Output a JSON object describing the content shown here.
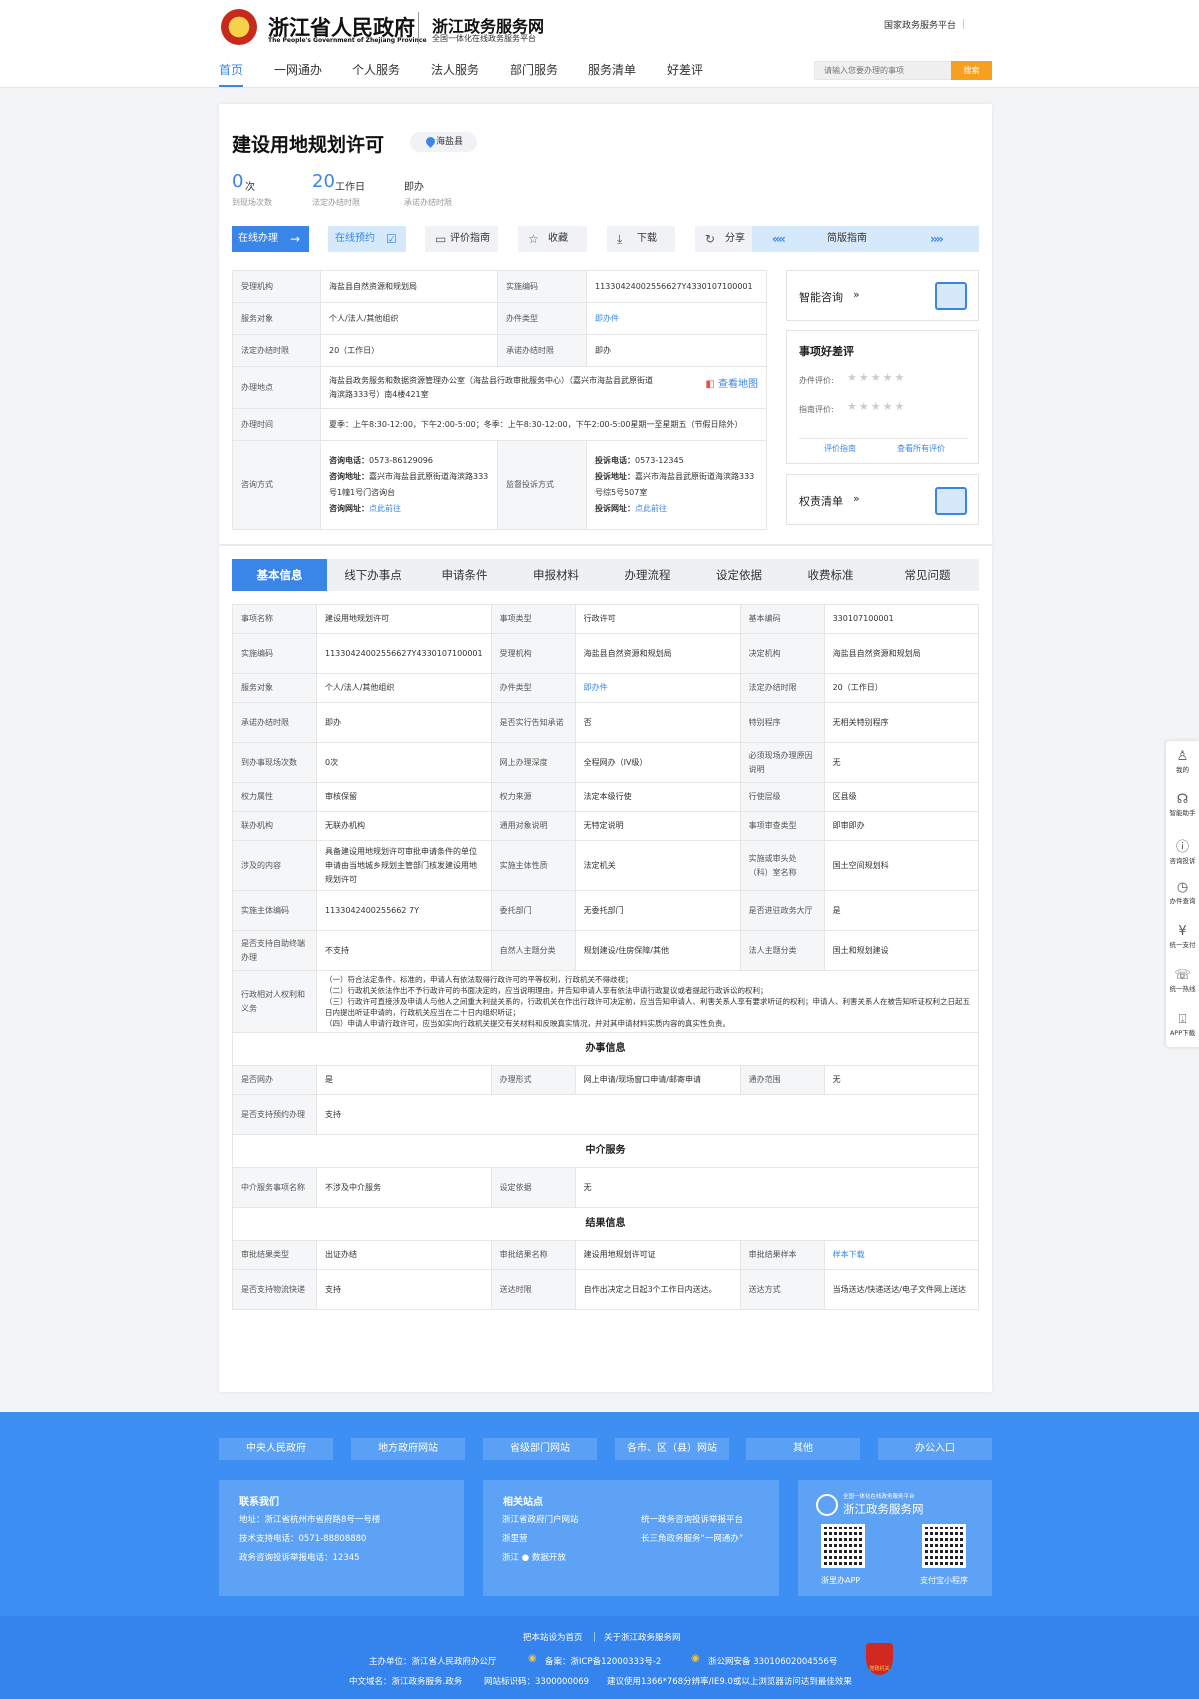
{
  "header": {
    "gov_cn": "浙江省人民政府",
    "gov_en": "The People's Government of Zhejiang Province",
    "site_title": "浙江政务服务网",
    "site_subtitle": "全国一体化在线政务服务平台",
    "national_link": "国家政务服务平台"
  },
  "nav": {
    "items": [
      "首页",
      "一网通办",
      "个人服务",
      "法人服务",
      "部门服务",
      "服务清单",
      "好差评"
    ],
    "search_placeholder": "请输入您要办理的事项",
    "search_button": "搜索"
  },
  "item": {
    "title": "建设用地规划许可",
    "region": "海盐县",
    "stats": [
      {
        "num": "0",
        "unit": "次",
        "label": "到现场次数"
      },
      {
        "num": "20",
        "unit": "工作日",
        "label": "法定办结时限"
      },
      {
        "num": "",
        "unit": "即办",
        "label": "承诺办结时限"
      }
    ],
    "buttons": {
      "online": "在线办理",
      "appointment": "在线预约",
      "evaluate_guide": "评价指南",
      "favorite": "收藏",
      "download": "下载",
      "share": "分享",
      "simple_guide": "简版指南"
    }
  },
  "info": {
    "accept_org_k": "受理机构",
    "accept_org_v": "海盐县自然资源和规划局",
    "impl_code_k": "实施编码",
    "impl_code_v": "11330424002556627Y4330107100001",
    "target_k": "服务对象",
    "target_v": "个人/法人/其他组织",
    "type_k": "办件类型",
    "type_v": "即办件",
    "legal_k": "法定办结时限",
    "legal_v": "20（工作日）",
    "promise_k": "承诺办结时限",
    "promise_v": "即办",
    "place_k": "办理地点",
    "place_v": "海盐县政务服务和数据资源管理办公室（海盐县行政审批服务中心）（嘉兴市海盐县武原街道海滨路333号）南4楼421室",
    "map_link": "查看地图",
    "time_k": "办理时间",
    "time_v": "夏季：上午8:30-12:00，下午2:00-5:00；冬季：上午8:30-12:00，下午2:00-5:00星期一至星期五（节假日除外）",
    "consult_k": "咨询方式",
    "consult_phone_k": "咨询电话：",
    "consult_phone_v": "0573-86129096",
    "consult_addr_k": "咨询地址：",
    "consult_addr_v": "嘉兴市海盐县武原街道海滨路333号1幢1号门咨询台",
    "consult_web_k": "咨询网址：",
    "consult_web_v": "点此前往",
    "complaint_k": "监督投诉方式",
    "complaint_phone_k": "投诉电话：",
    "complaint_phone_v": "0573-12345",
    "complaint_addr_k": "投诉地址：",
    "complaint_addr_v": "嘉兴市海盐县武原街道海滨路333号综5号507室",
    "complaint_web_k": "投诉网址：",
    "complaint_web_v": "点此前往"
  },
  "side": {
    "smart": "智能咨询",
    "review_title": "事项好差评",
    "review_rows": [
      "办件评价:",
      "指南评价:"
    ],
    "review_links": [
      "评价指南",
      "查看所有评价"
    ],
    "power_list": "权责清单"
  },
  "tabs": [
    "基本信息",
    "线下办事点",
    "申请条件",
    "申报材料",
    "办理流程",
    "设定依据",
    "收费标准",
    "常见问题"
  ],
  "basic": {
    "rows": [
      [
        "事项名称",
        "建设用地规划许可",
        "事项类型",
        "行政许可",
        "基本编码",
        "330107100001"
      ],
      [
        "实施编码",
        "11330424002556627Y4330107100001",
        "受理机构",
        "海盐县自然资源和规划局",
        "决定机构",
        "海盐县自然资源和规划局"
      ],
      [
        "服务对象",
        "个人/法人/其他组织",
        "办件类型",
        "即办件",
        "法定办结时限",
        "20（工作日）"
      ],
      [
        "承诺办结时限",
        "即办",
        "是否实行告知承诺",
        "否",
        "特别程序",
        "无相关特别程序"
      ],
      [
        "到办事现场次数",
        "0次",
        "网上办理深度",
        "全程网办（IV级）",
        "必须现场办理原因说明",
        "无"
      ],
      [
        "权力属性",
        "审核保留",
        "权力来源",
        "法定本级行使",
        "行使层级",
        "区县级"
      ],
      [
        "联办机构",
        "无联办机构",
        "通用对象说明",
        "无特定说明",
        "事项审查类型",
        "即审即办"
      ],
      [
        "涉及的内容",
        "具备建设用地规划许可审批申请条件的单位申请由当地城乡规划主管部门核发建设用地规划许可",
        "实施主体性质",
        "法定机关",
        "实施或审头处（科）室名称",
        "国土空间规划科"
      ],
      [
        "实施主体编码",
        "1133042400255662 7Y",
        "委托部门",
        "无委托部门",
        "是否进驻政务大厅",
        "是"
      ],
      [
        "是否支持自助终端办理",
        "不支持",
        "自然人主题分类",
        "规划建设/住房保障/其他",
        "法人主题分类",
        "国土和规划建设"
      ]
    ],
    "rights_k": "行政相对人权利和义务",
    "rights_v": [
      "（一）符合法定条件、标准的，申请人有依法取得行政许可的平等权利，行政机关不得歧视；",
      "（二）行政机关依法作出不予行政许可的书面决定的，应当说明理由，并告知申请人享有依法申请行政复议或者提起行政诉讼的权利；",
      "（三）行政许可直接涉及申请人与他人之间重大利益关系的，行政机关在作出行政许可决定前，应当告知申请人、利害关系人享有要求听证的权利；申请人、利害关系人在被告知听证权利之日起五日内提出听证申请的，行政机关应当在二十日内组织听证；",
      "（四）申请人申请行政许可，应当如实向行政机关提交有关材料和反映真实情况，并对其申请材料实质内容的真实性负责。"
    ],
    "section_office": "办事信息",
    "office_rows": [
      [
        "是否网办",
        "是",
        "办理形式",
        "网上申请/现场窗口申请/邮寄申请",
        "通办范围",
        "无"
      ]
    ],
    "office_extra": [
      "是否支持预约办理",
      "支持"
    ],
    "section_agency": "中介服务",
    "agency_row": [
      "中介服务事项名称",
      "不涉及中介服务",
      "设定依据",
      "无"
    ],
    "section_result": "结果信息",
    "result_rows": [
      [
        "审批结果类型",
        "出证办结",
        "审批结果名称",
        "建设用地规划许可证",
        "审批结果样本",
        "样本下载"
      ],
      [
        "是否支持物流快递",
        "支持",
        "送达时限",
        "自作出决定之日起3个工作日内送达。",
        "送达方式",
        "当场送达/快递送达/电子文件网上送达"
      ]
    ]
  },
  "float": [
    "我的",
    "智能助手",
    "咨询投诉",
    "办件查询",
    "统一支付",
    "统一热线",
    "APP下载"
  ],
  "footer": {
    "links": [
      "中央人民政府",
      "地方政府网站",
      "省级部门网站",
      "各市、区（县）网站",
      "其他",
      "办公入口"
    ],
    "contact_h": "联系我们",
    "contact": [
      "地址：浙江省杭州市省府路8号一号楼",
      "技术支持电话：0571-88808880",
      "政务咨询投诉举报电话：12345"
    ],
    "related_h": "相关站点",
    "related_l": [
      "浙江省政府门户网站",
      "浙里营",
      "浙江 ● 数据开放"
    ],
    "related_r": [
      "统一政务咨询投诉举报平台",
      "长三角政务服务“一网通办”"
    ],
    "brand_small": "全国一体化在线政务服务平台",
    "brand": "浙江政务服务网",
    "qr_labels": [
      "浙里办APP",
      "支付宝小程序"
    ],
    "bottom_links": [
      "把本站设为首页",
      "关于浙江政务服务网"
    ],
    "bottom_line1": [
      "主办单位：浙江省人民政府办公厅",
      "备案：浙ICP备12000333号-2",
      "浙公网安备 33010602004556号"
    ],
    "bottom_line2": [
      "中文域名：浙江政务服务.政务",
      "网站标识码：3300000069",
      "建议使用1366*768分辨率/IE9.0或以上浏览器访问达到最佳效果"
    ],
    "badge": "党政机关"
  }
}
